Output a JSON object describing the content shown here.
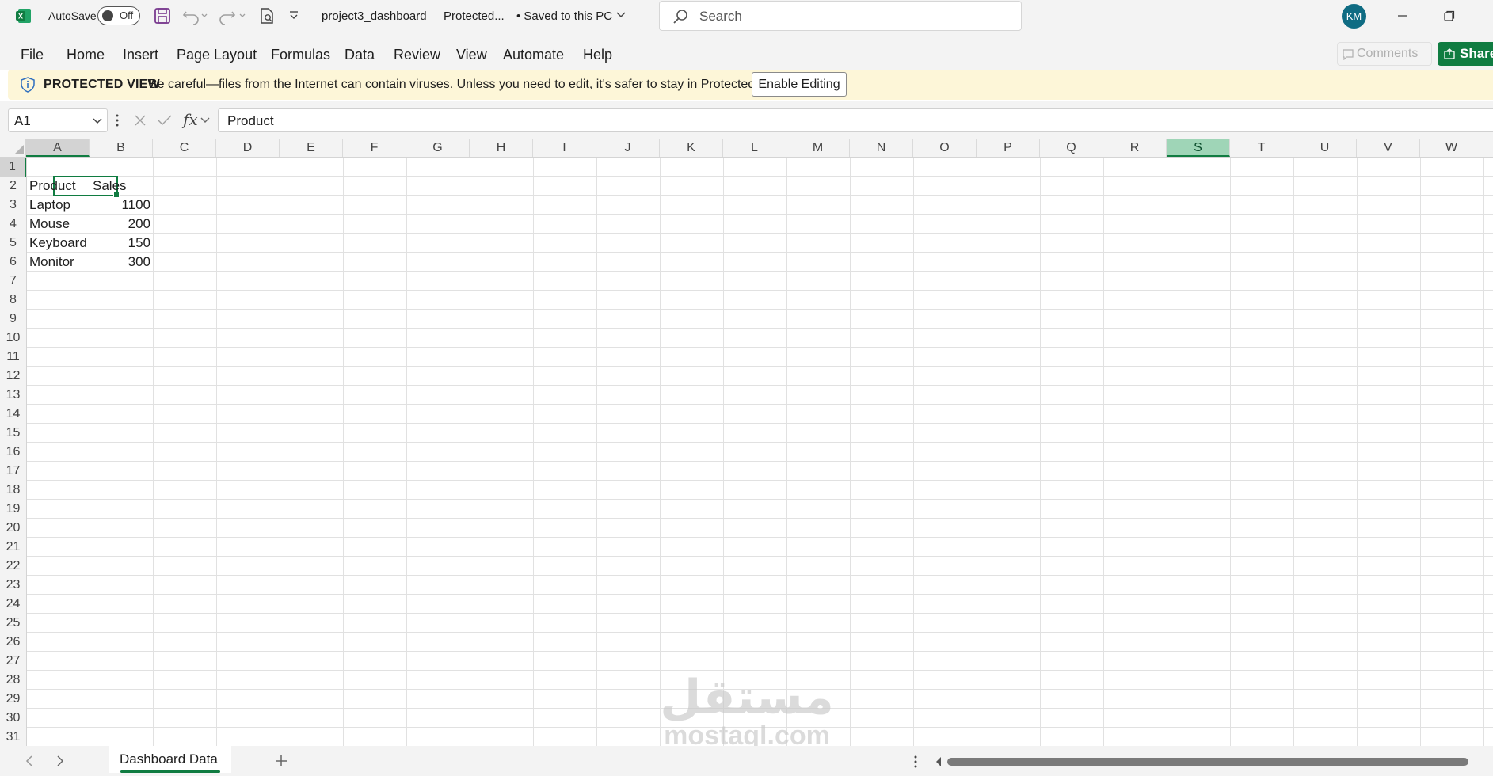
{
  "app": {
    "logo_letter": "X"
  },
  "titlebar": {
    "autosave_label": "AutoSave",
    "autosave_state": "Off",
    "filename": "project3_dashboard",
    "mode": "Protected...",
    "saved_status": "• Saved to this PC",
    "search_placeholder": "Search",
    "user_initials": "KM"
  },
  "menu": {
    "items": [
      "File",
      "Home",
      "Insert",
      "Page Layout",
      "Formulas",
      "Data",
      "Review",
      "View",
      "Automate",
      "Help"
    ],
    "comments_label": "Comments",
    "share_label": "Share"
  },
  "protected_view": {
    "title": "PROTECTED VIEW",
    "message": "Be careful—files from the Internet can contain viruses. Unless you need to edit, it's safer to stay in Protected View.",
    "enable_label": "Enable Editing"
  },
  "formula_bar": {
    "name_box": "A1",
    "formula": "Product",
    "fx_label": "fx"
  },
  "columns": [
    "A",
    "B",
    "C",
    "D",
    "E",
    "F",
    "G",
    "H",
    "I",
    "J",
    "K",
    "L",
    "M",
    "N",
    "O",
    "P",
    "Q",
    "R",
    "S",
    "T",
    "U",
    "V",
    "W"
  ],
  "rows": [
    "1",
    "2",
    "3",
    "4",
    "5",
    "6",
    "7",
    "8",
    "9",
    "10",
    "11",
    "12",
    "13",
    "14",
    "15",
    "16",
    "17",
    "18",
    "19",
    "20",
    "21",
    "22",
    "23",
    "24",
    "25",
    "26",
    "27",
    "28",
    "29",
    "30",
    "31"
  ],
  "sheet": {
    "header": {
      "product": "Product",
      "sales": "Sales"
    },
    "data": [
      {
        "product": "Laptop",
        "sales": "1100"
      },
      {
        "product": "Mouse",
        "sales": "200"
      },
      {
        "product": "Keyboard",
        "sales": "150"
      },
      {
        "product": "Monitor",
        "sales": "300"
      }
    ]
  },
  "watermark": {
    "arabic": "مستقل",
    "latin": "mostaql.com"
  },
  "tabs": {
    "active_sheet": "Dashboard Data"
  },
  "colors": {
    "accent": "#107c41",
    "selected_column": "#9fd5b7",
    "protected_bar": "#fdf6d8"
  }
}
